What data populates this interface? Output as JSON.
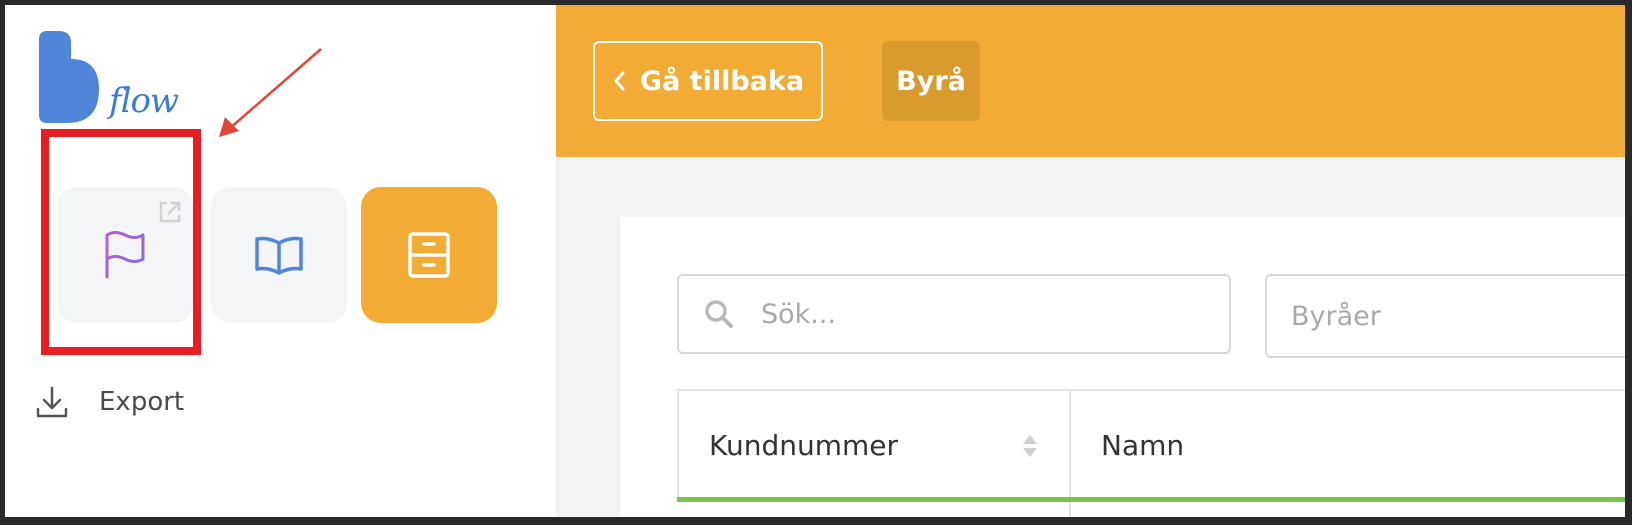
{
  "sidebar": {
    "logo_text": "flow",
    "apps": [
      {
        "name": "flag-app",
        "icon": "flag-icon",
        "active": false
      },
      {
        "name": "book-app",
        "icon": "book-icon",
        "active": false
      },
      {
        "name": "cabinet-app",
        "icon": "file-cabinet-icon",
        "active": true
      }
    ],
    "export_label": "Export"
  },
  "header": {
    "back_label": "Gå tillbaka",
    "tab_label": "Byrå"
  },
  "filters": {
    "search_placeholder": "Sök...",
    "agency_select": "Byråer"
  },
  "table": {
    "columns": [
      "Kundnummer",
      "Namn"
    ]
  },
  "colors": {
    "accent": "#f2ab34",
    "highlight": "#e81e25",
    "table_rule": "#7cc34a"
  }
}
